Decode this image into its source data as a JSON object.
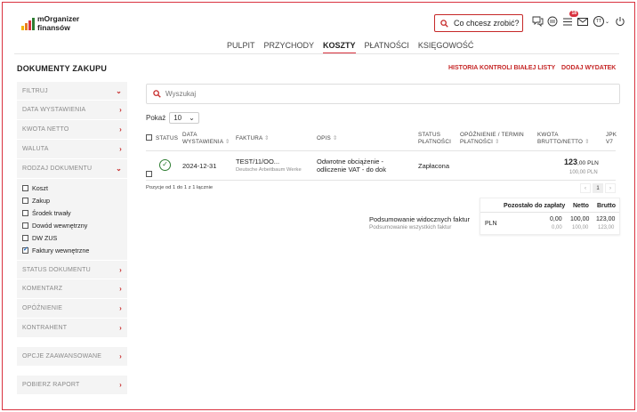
{
  "brand": {
    "line1": "mOrganizer",
    "line2": "finansów",
    "bar_colors": [
      "#f4b400",
      "#e67c22",
      "#d9323f",
      "#2e7d32"
    ]
  },
  "header": {
    "quick_action_placeholder": "Co chcesz zrobić?",
    "notification_count": "18",
    "user_initials": "TT",
    "icons": [
      "chat-icon",
      "currency-icon",
      "tasks-icon",
      "mail-icon",
      "user-icon",
      "power-icon"
    ]
  },
  "nav": {
    "items": [
      "PULPIT",
      "PRZYCHODY",
      "KOSZTY",
      "PŁATNOŚCI",
      "KSIĘGOWOŚĆ"
    ],
    "active": "KOSZTY"
  },
  "page": {
    "title": "DOKUMENTY ZAKUPU",
    "link_history": "HISTORIA KONTROLI BIAŁEJ LISTY",
    "link_add": "DODAJ WYDATEK"
  },
  "sidebar": {
    "filter": "FILTRUJ",
    "sections": [
      "DATA WYSTAWIENIA",
      "KWOTA NETTO",
      "WALUTA",
      "RODZAJ DOKUMENTU"
    ],
    "doc_types": [
      {
        "label": "Koszt",
        "checked": false
      },
      {
        "label": "Zakup",
        "checked": false
      },
      {
        "label": "Środek trwały",
        "checked": false
      },
      {
        "label": "Dowód wewnętrzny",
        "checked": false
      },
      {
        "label": "DW ZUS",
        "checked": false
      },
      {
        "label": "Faktury wewnętrzne",
        "checked": true
      }
    ],
    "sections_after": [
      "STATUS DOKUMENTU",
      "KOMENTARZ",
      "OPÓŹNIENIE",
      "KONTRAHENT"
    ],
    "advanced": "OPCJE ZAAWANSOWANE",
    "report": "POBIERZ RAPORT"
  },
  "search": {
    "placeholder": "Wyszukaj"
  },
  "table": {
    "show_label": "Pokaż",
    "page_size": "10",
    "headers": {
      "status": "STATUS",
      "date_1": "DATA",
      "date_2": "WYSTAWIENIA",
      "invoice": "FAKTURA",
      "description": "OPIS",
      "pay_status_1": "STATUS",
      "pay_status_2": "PŁATNOŚCI",
      "delay_1": "OPÓŹNIENIE / TERMIN",
      "delay_2": "PŁATNOŚCI",
      "amount_1": "KWOTA",
      "amount_2": "BRUTTO/NETTO",
      "jpk_1": "JPK",
      "jpk_2": "V7"
    },
    "rows": [
      {
        "date": "2024-12-31",
        "invoice": "TEST/11/OO...",
        "contractor": "Deutsche Arbeitbaum Werke",
        "description_1": "Odwrotne obciążenie -",
        "description_2": "odliczenie VAT - do dok",
        "payment_status": "Zapłacona",
        "gross_main": "123",
        "gross_dec": ",00",
        "currency": "PLN",
        "net": "100,00 PLN"
      }
    ],
    "info": "Pozycje od 1 do 1 z 1 łącznie",
    "pagination": {
      "prev": "‹",
      "current": "1",
      "next": "›"
    }
  },
  "summary": {
    "visible_label": "Podsumowanie widocznych faktur",
    "all_label": "Podsumowanie wszystkich faktur",
    "col_remaining": "Pozostało do zapłaty",
    "col_net": "Netto",
    "col_gross": "Brutto",
    "currency": "PLN",
    "visible": {
      "remaining": "0,00",
      "net": "100,00",
      "gross": "123,00"
    },
    "all": {
      "remaining": "0,00",
      "net": "100,00",
      "gross": "123,00"
    }
  }
}
